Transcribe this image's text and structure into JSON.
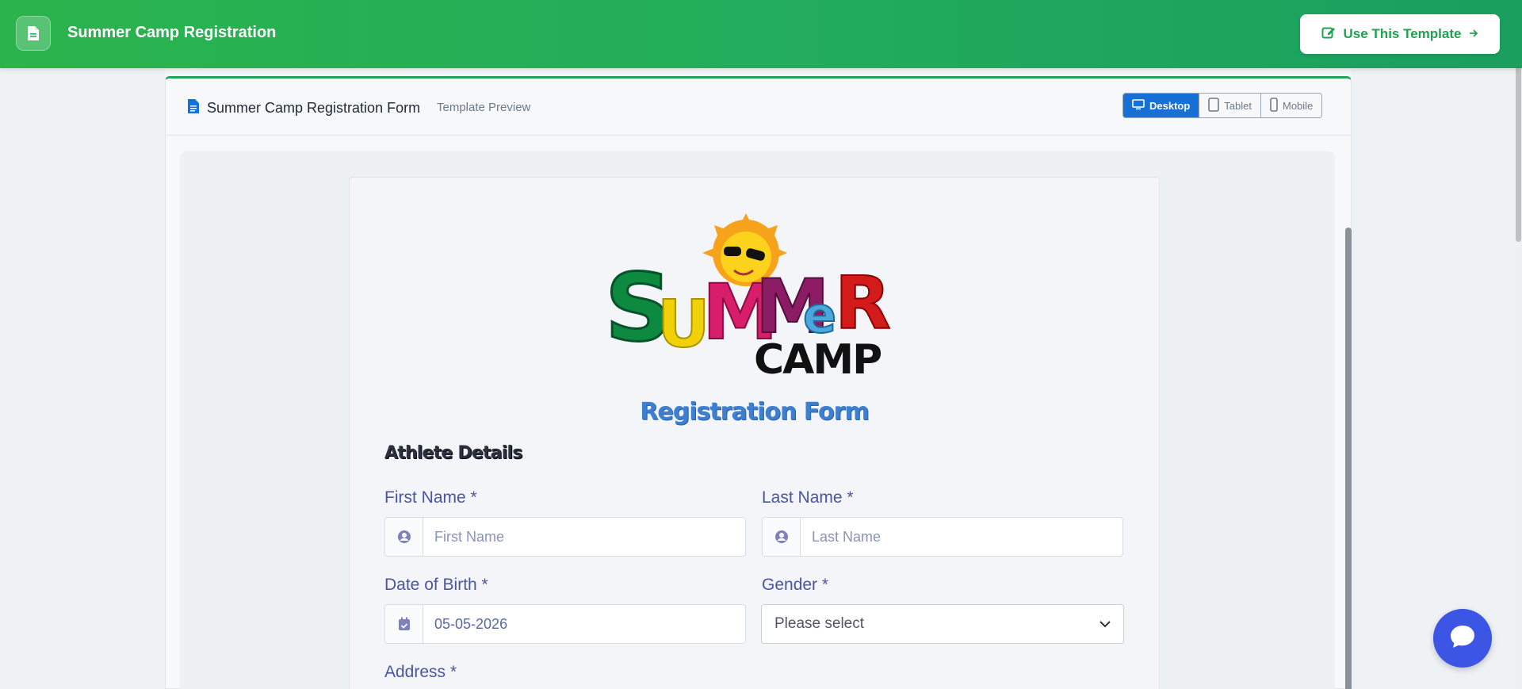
{
  "topbar": {
    "title": "Summer Camp Registration",
    "use_template_label": "Use This Template"
  },
  "panel": {
    "title": "Summer Camp Registration Form",
    "subtitle": "Template Preview",
    "devices": [
      {
        "label": "Desktop",
        "active": true
      },
      {
        "label": "Tablet",
        "active": false
      },
      {
        "label": "Mobile",
        "active": false
      }
    ]
  },
  "form": {
    "logo": {
      "line1": "SUMMER",
      "line2": "CAMP"
    },
    "heading": "Registration Form",
    "section": "Athlete Details",
    "first_name": {
      "label": "First Name *",
      "placeholder": "First Name"
    },
    "last_name": {
      "label": "Last Name *",
      "placeholder": "Last Name"
    },
    "dob": {
      "label": "Date of Birth *",
      "value": "05-05-2026"
    },
    "gender": {
      "label": "Gender *",
      "value": "Please select"
    },
    "address": {
      "label": "Address *"
    }
  },
  "colors": {
    "brand_green": "#22ad5c",
    "active_blue": "#1670d6",
    "label_purple": "#4a55a2",
    "chat_blue": "#3d55e4"
  }
}
